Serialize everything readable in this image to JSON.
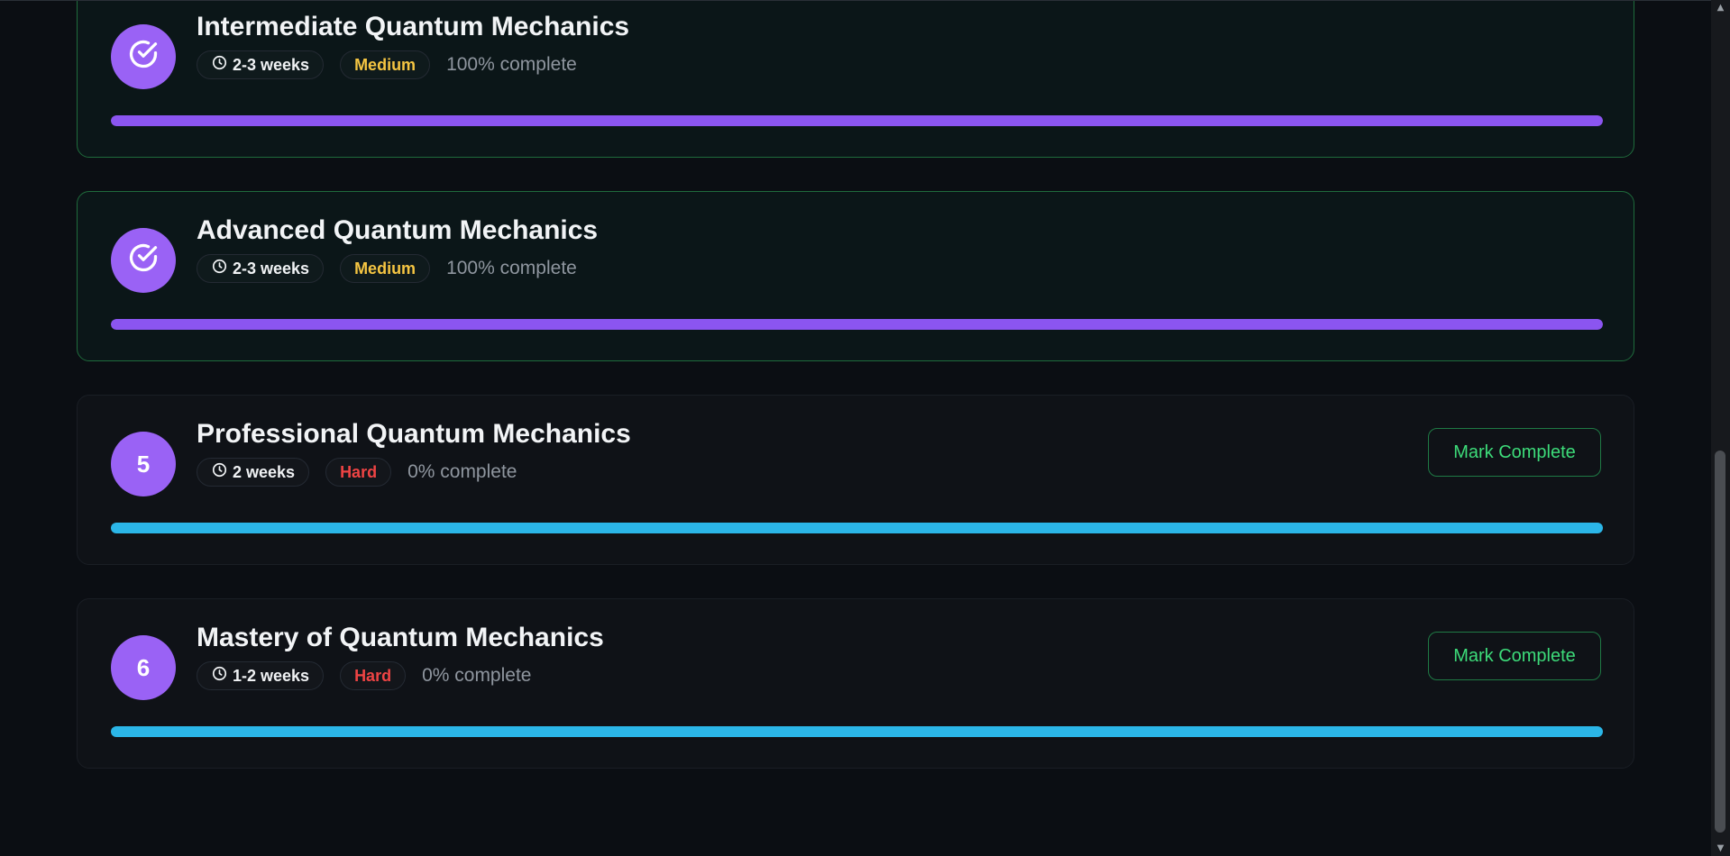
{
  "modules": [
    {
      "status": "completed",
      "icon": "check-circle-icon",
      "title": "Intermediate Quantum Mechanics",
      "duration": "2-3 weeks",
      "difficulty": "Medium",
      "progress_text": "100% complete",
      "progress": 1.0
    },
    {
      "status": "completed",
      "icon": "check-circle-icon",
      "title": "Advanced Quantum Mechanics",
      "duration": "2-3 weeks",
      "difficulty": "Medium",
      "progress_text": "100% complete",
      "progress": 1.0
    },
    {
      "status": "pending",
      "number": "5",
      "title": "Professional Quantum Mechanics",
      "duration": "2 weeks",
      "difficulty": "Hard",
      "progress_text": "0% complete",
      "progress": 0.0,
      "action_label": "Mark Complete"
    },
    {
      "status": "pending",
      "number": "6",
      "title": "Mastery of Quantum Mechanics",
      "duration": "1-2 weeks",
      "difficulty": "Hard",
      "progress_text": "0% complete",
      "progress": 0.0,
      "action_label": "Mark Complete"
    }
  ],
  "colors": {
    "accent_purple": "#9a62f5",
    "progress_purple": "#8b55f0",
    "pending_bar_cyan": "#2bb6e8",
    "completed_border": "#1f6b3c",
    "medium": "#f5c542",
    "hard": "#ef4444",
    "action_green": "#3ddc7a"
  }
}
